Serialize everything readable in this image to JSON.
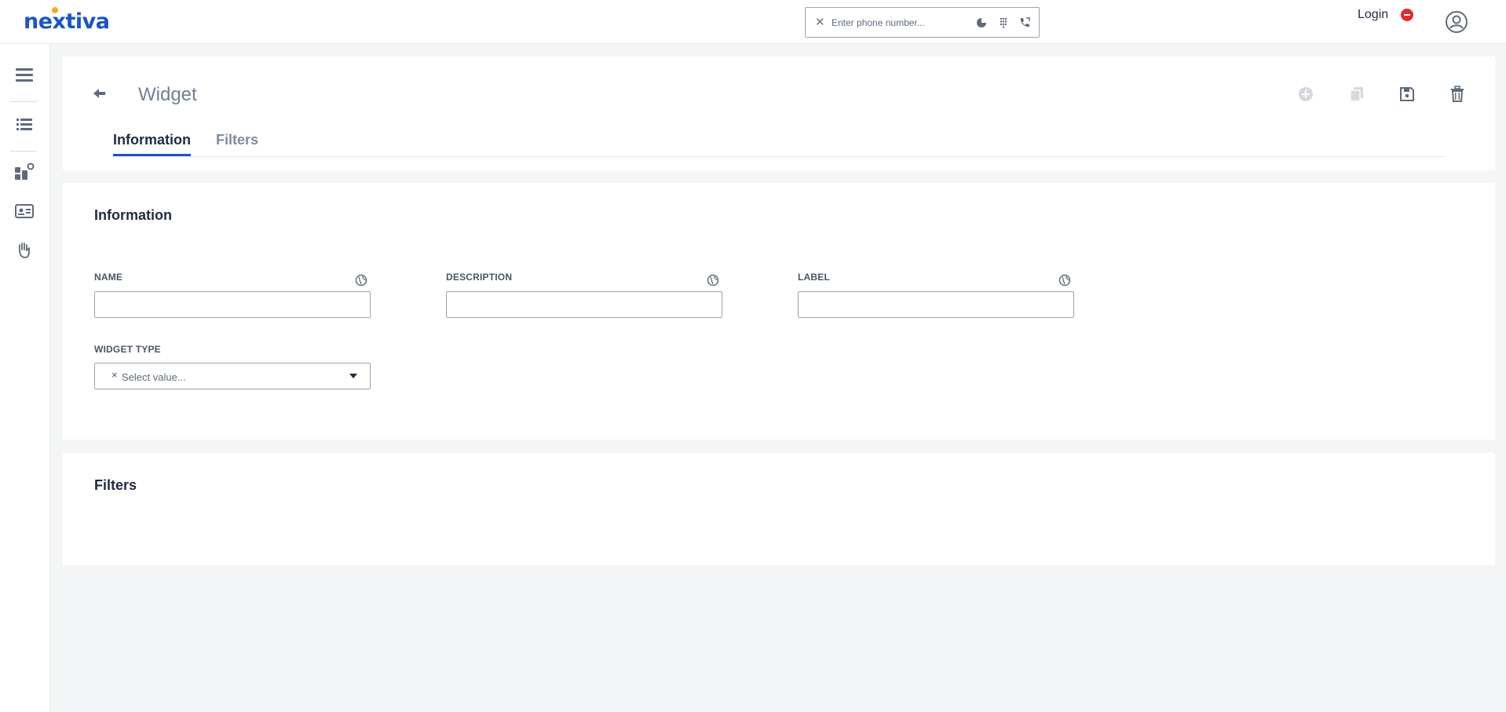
{
  "header": {
    "logo_text": "nextiva",
    "phone_placeholder": "Enter phone number...",
    "phone_clear_glyph": "✕",
    "login_label": "Login",
    "status_color": "#e12d2d"
  },
  "sidebar": {
    "items": [
      {
        "name": "menu-icon"
      },
      {
        "name": "list-icon"
      },
      {
        "name": "widgets-icon"
      },
      {
        "name": "contact-card-icon"
      },
      {
        "name": "hand-icon"
      }
    ]
  },
  "page": {
    "title": "Widget",
    "tabs": [
      {
        "label": "Information",
        "active": true
      },
      {
        "label": "Filters",
        "active": false
      }
    ],
    "toolbar": [
      "add-icon",
      "copy-icon",
      "save-icon",
      "delete-icon"
    ]
  },
  "information": {
    "section_title": "Information",
    "fields": {
      "name_label": "NAME",
      "description_label": "DESCRIPTION",
      "label_label": "LABEL",
      "widget_type_label": "WIDGET TYPE",
      "widget_type_placeholder": "Select value...",
      "widget_type_clear": "×"
    }
  },
  "filters": {
    "section_title": "Filters"
  },
  "colors": {
    "accent": "#1a55c4",
    "logo_dot": "#f7a823",
    "title_gray": "#6f7f96"
  }
}
